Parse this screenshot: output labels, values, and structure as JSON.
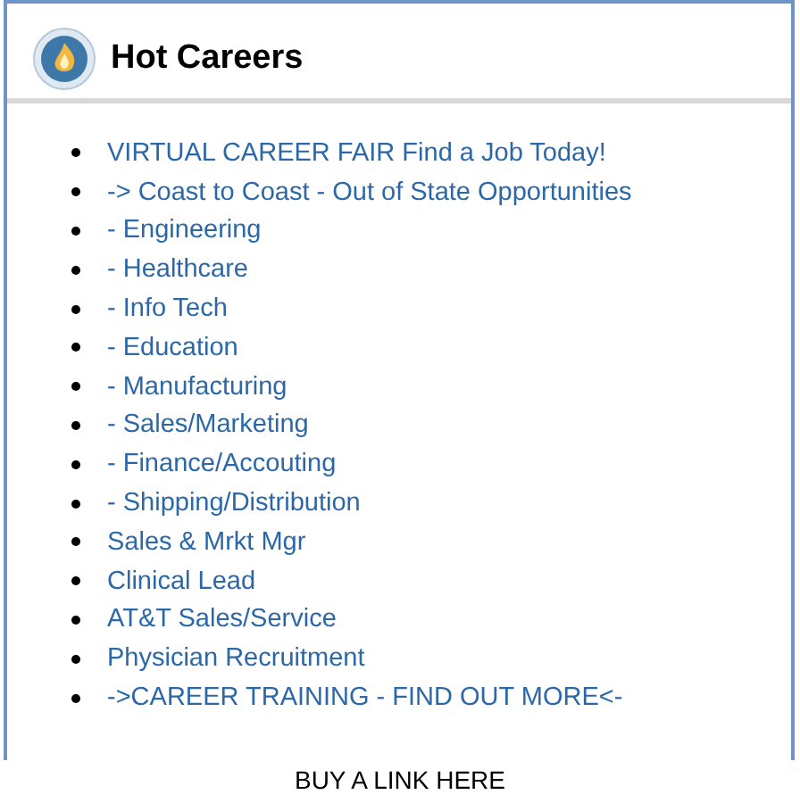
{
  "panel": {
    "title": "Hot Careers",
    "links": [
      "VIRTUAL CAREER FAIR Find a Job Today!",
      "-> Coast to Coast - Out of State Opportunities",
      "- Engineering",
      "- Healthcare",
      "- Info Tech",
      "- Education",
      "- Manufacturing",
      "- Sales/Marketing",
      "- Finance/Accouting",
      "- Shipping/Distribution",
      "Sales & Mrkt Mgr",
      "Clinical Lead",
      "AT&T Sales/Service",
      "Physician Recruitment",
      "->CAREER TRAINING - FIND OUT MORE<-"
    ]
  },
  "footer_link": "BUY A LINK HERE"
}
